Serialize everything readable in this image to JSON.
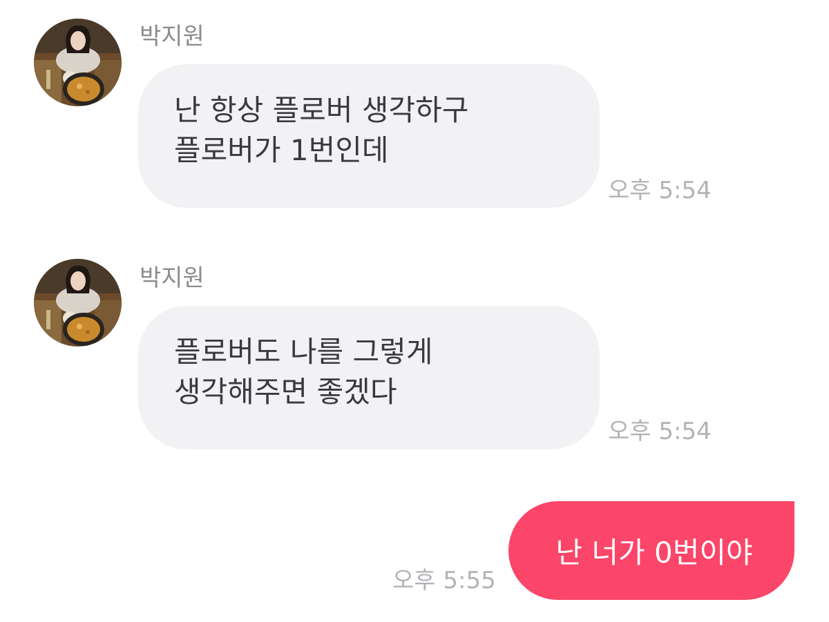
{
  "messages": [
    {
      "direction": "incoming",
      "sender": "박지원",
      "avatar": "profile-photo",
      "lines": [
        "난 항상 플로버 생각하구",
        "플로버가 1번인데"
      ],
      "time": "오후 5:54"
    },
    {
      "direction": "incoming",
      "sender": "박지원",
      "avatar": "profile-photo",
      "lines": [
        "플로버도 나를 그렇게",
        "생각해주면 좋겠다"
      ],
      "time": "오후 5:54"
    },
    {
      "direction": "outgoing",
      "lines": [
        "난 너가 0번이야"
      ],
      "time": "오후 5:55"
    }
  ],
  "colors": {
    "background": "#ffffff",
    "incoming_bubble": "#f2f2f4",
    "outgoing_bubble": "#fb4569",
    "sender_name": "#8b8b90",
    "timestamp": "#b2b2b7",
    "message_text": "#3a3a3e",
    "outgoing_text": "#ffffff"
  }
}
